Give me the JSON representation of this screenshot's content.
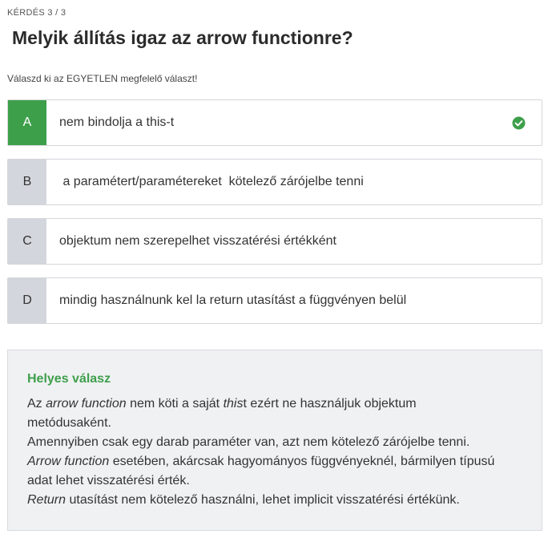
{
  "counter": "KÉRDÉS 3 / 3",
  "question": "Melyik állítás igaz az arrow functionre?",
  "instruction": "Válaszd ki az EGYETLEN megfelelő választ!",
  "options": [
    {
      "letter": "A",
      "text": "nem bindolja a this-t",
      "correct": true
    },
    {
      "letter": "B",
      "text": " a paramétert/paramétereket  kötelező zárójelbe tenni",
      "correct": false
    },
    {
      "letter": "C",
      "text": "objektum nem szerepelhet visszatérési értékként",
      "correct": false
    },
    {
      "letter": "D",
      "text": "mindig használnunk kel la return utasítást a függvényen belül",
      "correct": false
    }
  ],
  "icons": {
    "correct": "check-circle-icon",
    "correct_color": "#3e9f4b"
  },
  "explanation": {
    "title": "Helyes válasz",
    "p1": {
      "pre": "Az ",
      "em1": "arrow function",
      "mid": " nem köti a saját ",
      "em2": "this",
      "post": "t ezért ne használjuk objektum"
    },
    "p1b": "metódusaként.",
    "p2": "Amennyiben csak egy darab paraméter van, azt nem kötelező zárójelbe tenni.",
    "p3": {
      "em": "Arrow function",
      "post": " esetében, akárcsak hagyományos függvényeknél, bármilyen típusú"
    },
    "p3b": "adat lehet visszatérési érték.",
    "p4": {
      "em": "Return",
      "post": " utasítást nem kötelező használni, lehet implicit visszatérési értékünk."
    }
  }
}
